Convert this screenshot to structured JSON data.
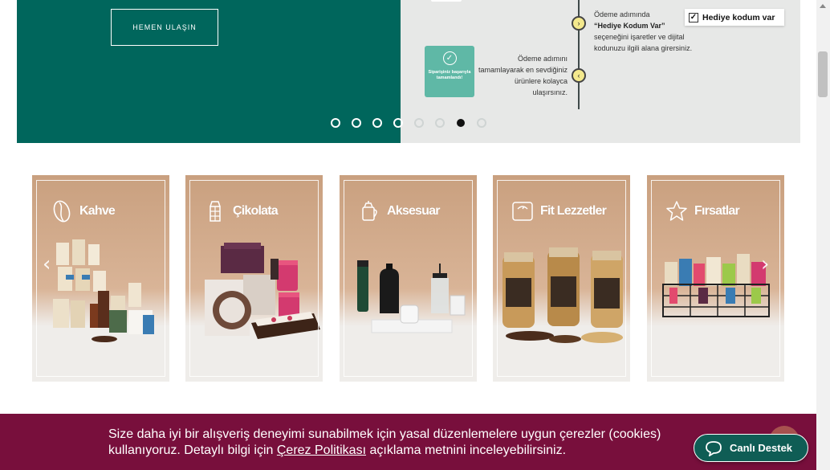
{
  "hero": {
    "cta_label": "HEMEN ULAŞIN",
    "step_gift_line1": "Ödeme adımında",
    "step_gift_bold": "“Hediye Kodum Var”",
    "step_gift_line2": "seçeneğini işaretler ve dijital kodunuzu ilgili alana girersiniz.",
    "gift_checkbox_label": "Hediye kodum var",
    "step_payment": "Ödeme adımını tamamlayarak en sevdiğiniz ürünlere kolayca ulaşırsınız.",
    "success_text": "Siparişiniz başarıyla tamamlandı!",
    "slide_count": 8,
    "active_slide": 7
  },
  "categories": [
    {
      "label": "Kahve",
      "icon": "coffee-bean-icon"
    },
    {
      "label": "Çikolata",
      "icon": "chocolate-bar-icon"
    },
    {
      "label": "Aksesuar",
      "icon": "coffee-pot-icon"
    },
    {
      "label": "Fit Lezzetler",
      "icon": "scale-icon"
    },
    {
      "label": "Fırsatlar",
      "icon": "star-icon"
    }
  ],
  "cookie": {
    "text_before": "Size daha iyi bir alışveriş deneyimi sunabilmek için yasal düzenlemelere uygun çerezler (cookies) kullanıyoruz. Detaylı bilgi için ",
    "link_label": "Çerez Politikası",
    "text_after": " açıklama metnini inceleyebilirsiniz."
  },
  "support": {
    "label": "Canlı Destek"
  },
  "colors": {
    "brand_green": "#00665c",
    "cookie_bg": "#780f3c",
    "support_bg": "#0f5d55",
    "card_tan": "#d9b497"
  }
}
